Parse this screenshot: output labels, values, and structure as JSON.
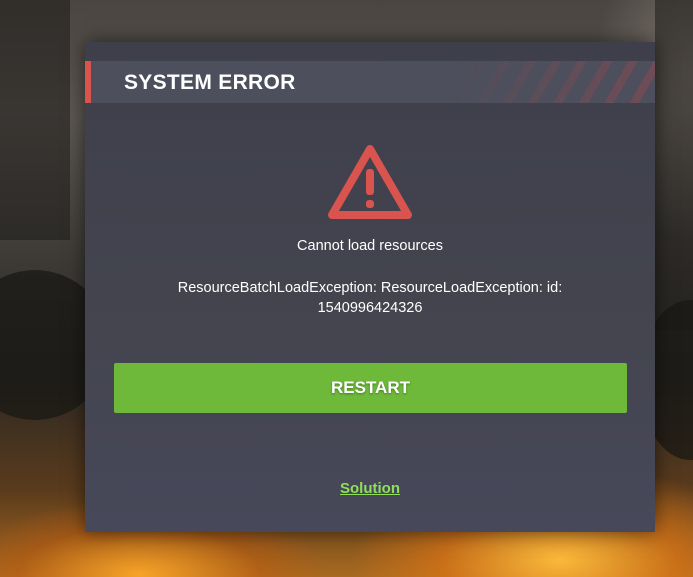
{
  "dialog": {
    "title": "SYSTEM ERROR",
    "icon": "warning-triangle-icon",
    "message": "Cannot load resources",
    "detail_line1": "ResourceBatchLoadException: ResourceLoadException: id:",
    "detail_line2": "1540996424326",
    "restart_label": "RESTART",
    "solution_label": "Solution"
  },
  "colors": {
    "accent_red": "#d9534f",
    "button_green": "#6eb83a",
    "link_green": "#8ee05a",
    "panel": "#43444f"
  }
}
